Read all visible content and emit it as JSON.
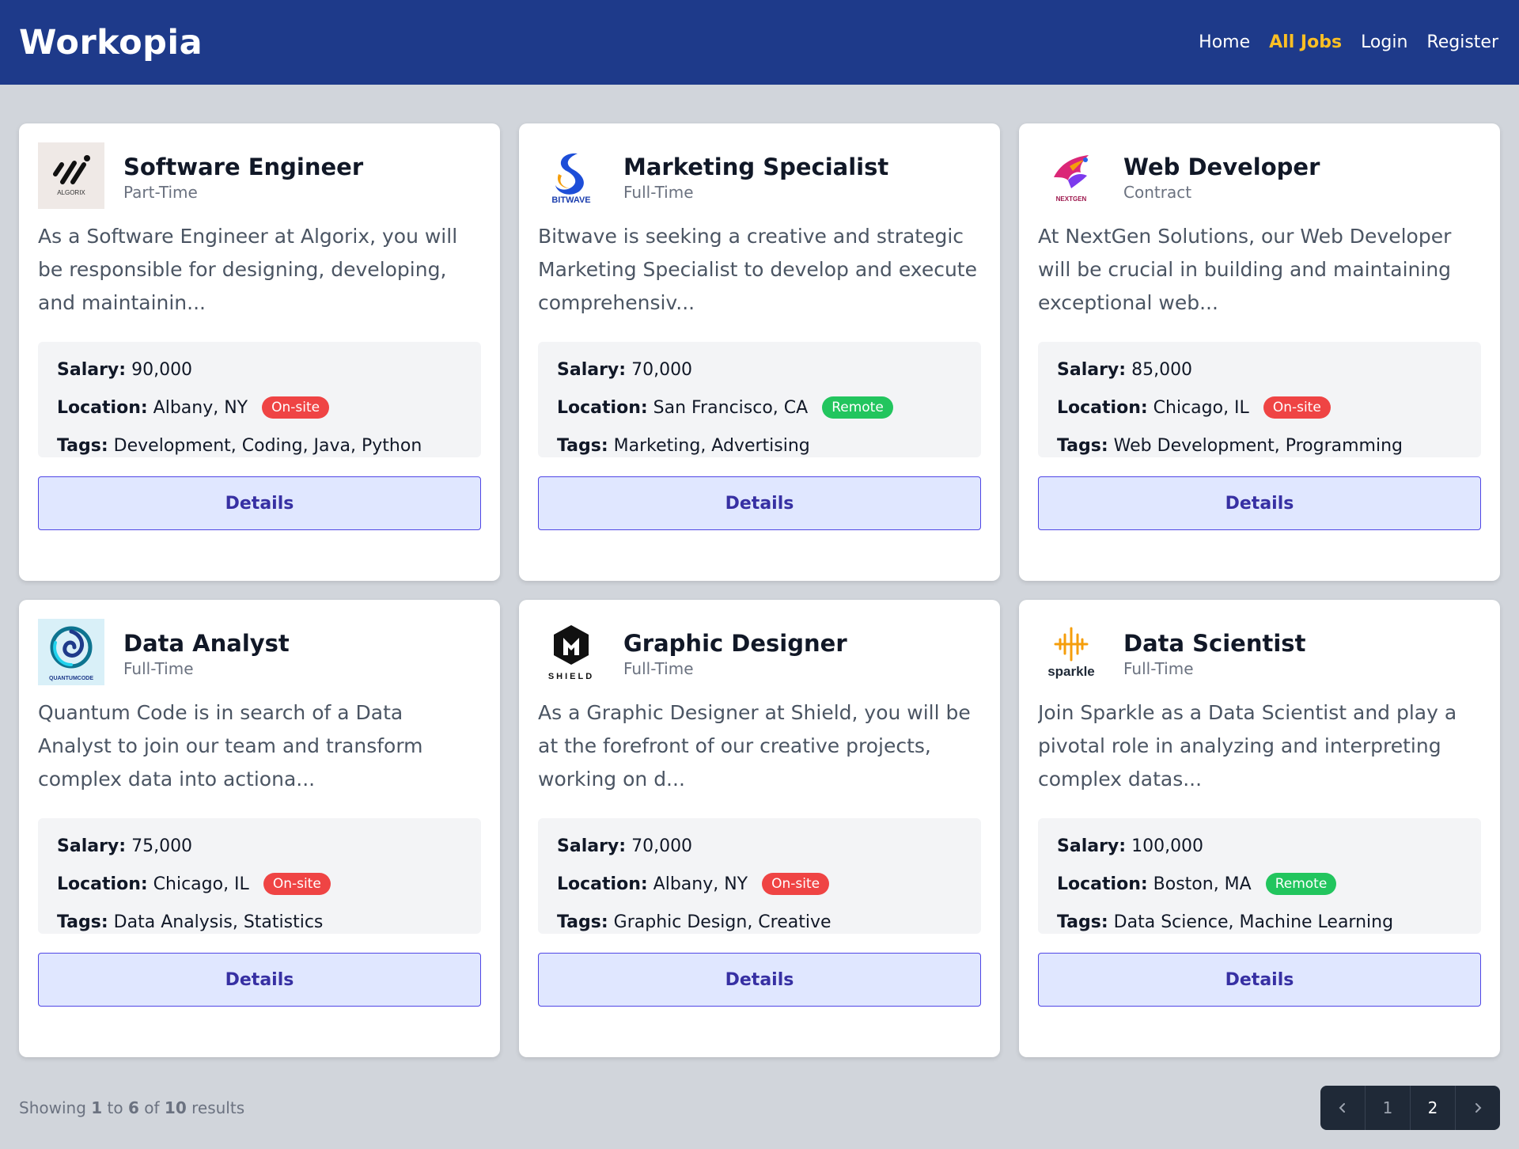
{
  "header": {
    "brand": "Workopia",
    "nav": [
      "Home",
      "All Jobs",
      "Login",
      "Register"
    ],
    "active_nav": "All Jobs"
  },
  "labels": {
    "salary": "Salary:",
    "location": "Location:",
    "tags": "Tags:",
    "details": "Details"
  },
  "jobs": [
    {
      "logo_name": "algorix-logo",
      "logo_text": "ALGORIX",
      "title": "Software Engineer",
      "type": "Part-Time",
      "description": "As a Software Engineer at Algorix, you will be responsible for designing, developing, and maintainin...",
      "salary": "90,000",
      "location": "Albany, NY",
      "badge": "On-site",
      "tags": "Development, Coding, Java, Python"
    },
    {
      "logo_name": "bitwave-logo",
      "logo_text": "BITWAVE",
      "title": "Marketing Specialist",
      "type": "Full-Time",
      "description": "Bitwave is seeking a creative and strategic Marketing Specialist to develop and execute comprehensiv...",
      "salary": "70,000",
      "location": "San Francisco, CA",
      "badge": "Remote",
      "tags": "Marketing, Advertising"
    },
    {
      "logo_name": "nextgen-logo",
      "logo_text": "NEXTGEN",
      "title": "Web Developer",
      "type": "Contract",
      "description": "At NextGen Solutions, our Web Developer will be crucial in building and maintaining exceptional web...",
      "salary": "85,000",
      "location": "Chicago, IL",
      "badge": "On-site",
      "tags": "Web Development, Programming"
    },
    {
      "logo_name": "quantumcode-logo",
      "logo_text": "QUANTUMCODE",
      "title": "Data Analyst",
      "type": "Full-Time",
      "description": "Quantum Code is in search of a Data Analyst to join our team and transform complex data into actiona...",
      "salary": "75,000",
      "location": "Chicago, IL",
      "badge": "On-site",
      "tags": "Data Analysis, Statistics"
    },
    {
      "logo_name": "shield-logo",
      "logo_text": "SHIELD",
      "title": "Graphic Designer",
      "type": "Full-Time",
      "description": "As a Graphic Designer at Shield, you will be at the forefront of our creative projects, working on d...",
      "salary": "70,000",
      "location": "Albany, NY",
      "badge": "On-site",
      "tags": "Graphic Design, Creative"
    },
    {
      "logo_name": "sparkle-logo",
      "logo_text": "sparkle",
      "title": "Data Scientist",
      "type": "Full-Time",
      "description": "Join Sparkle as a Data Scientist and play a pivotal role in analyzing and interpreting complex datas...",
      "salary": "100,000",
      "location": "Boston, MA",
      "badge": "Remote",
      "tags": "Data Science, Machine Learning"
    }
  ],
  "colors": {
    "header_bg": "#1e3a8a",
    "active_nav": "#fbbf24",
    "onsite": "#ef4444",
    "remote": "#22c55e",
    "details_bg": "#e0e7ff"
  },
  "footer": {
    "showing": "Showing",
    "from": "1",
    "to_word": "to",
    "to": "6",
    "of_word": "of",
    "total": "10",
    "results": "results"
  },
  "pagination": {
    "prev_icon": "chevron-left-icon",
    "pages": [
      "1",
      "2"
    ],
    "next_icon": "chevron-right-icon"
  }
}
